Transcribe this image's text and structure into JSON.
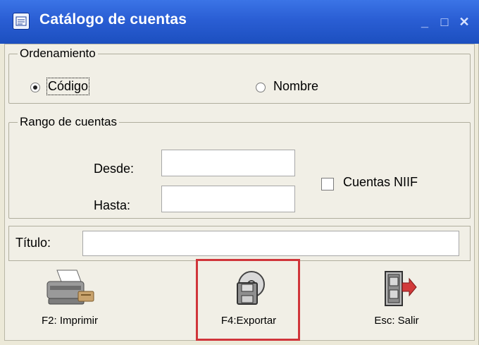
{
  "window": {
    "title": "Catálogo de cuentas",
    "controls": {
      "minimize": "_",
      "maximize": "□",
      "close": "✕"
    }
  },
  "ordenamiento": {
    "legend": "Ordenamiento",
    "options": [
      {
        "label": "Código",
        "selected": true
      },
      {
        "label": "Nombre",
        "selected": false
      }
    ]
  },
  "rango": {
    "legend": "Rango de cuentas",
    "desde_label": "Desde:",
    "desde_value": "",
    "hasta_label": "Hasta:",
    "hasta_value": "",
    "niif_label": "Cuentas NIIF",
    "niif_checked": false
  },
  "titulo": {
    "label": "Título:",
    "value": ""
  },
  "buttons": {
    "imprimir": "F2: Imprimir",
    "exportar": "F4:Exportar",
    "salir": "Esc: Salir"
  },
  "colors": {
    "titlebar": "#2a5ed4",
    "highlight": "#d0353a"
  }
}
